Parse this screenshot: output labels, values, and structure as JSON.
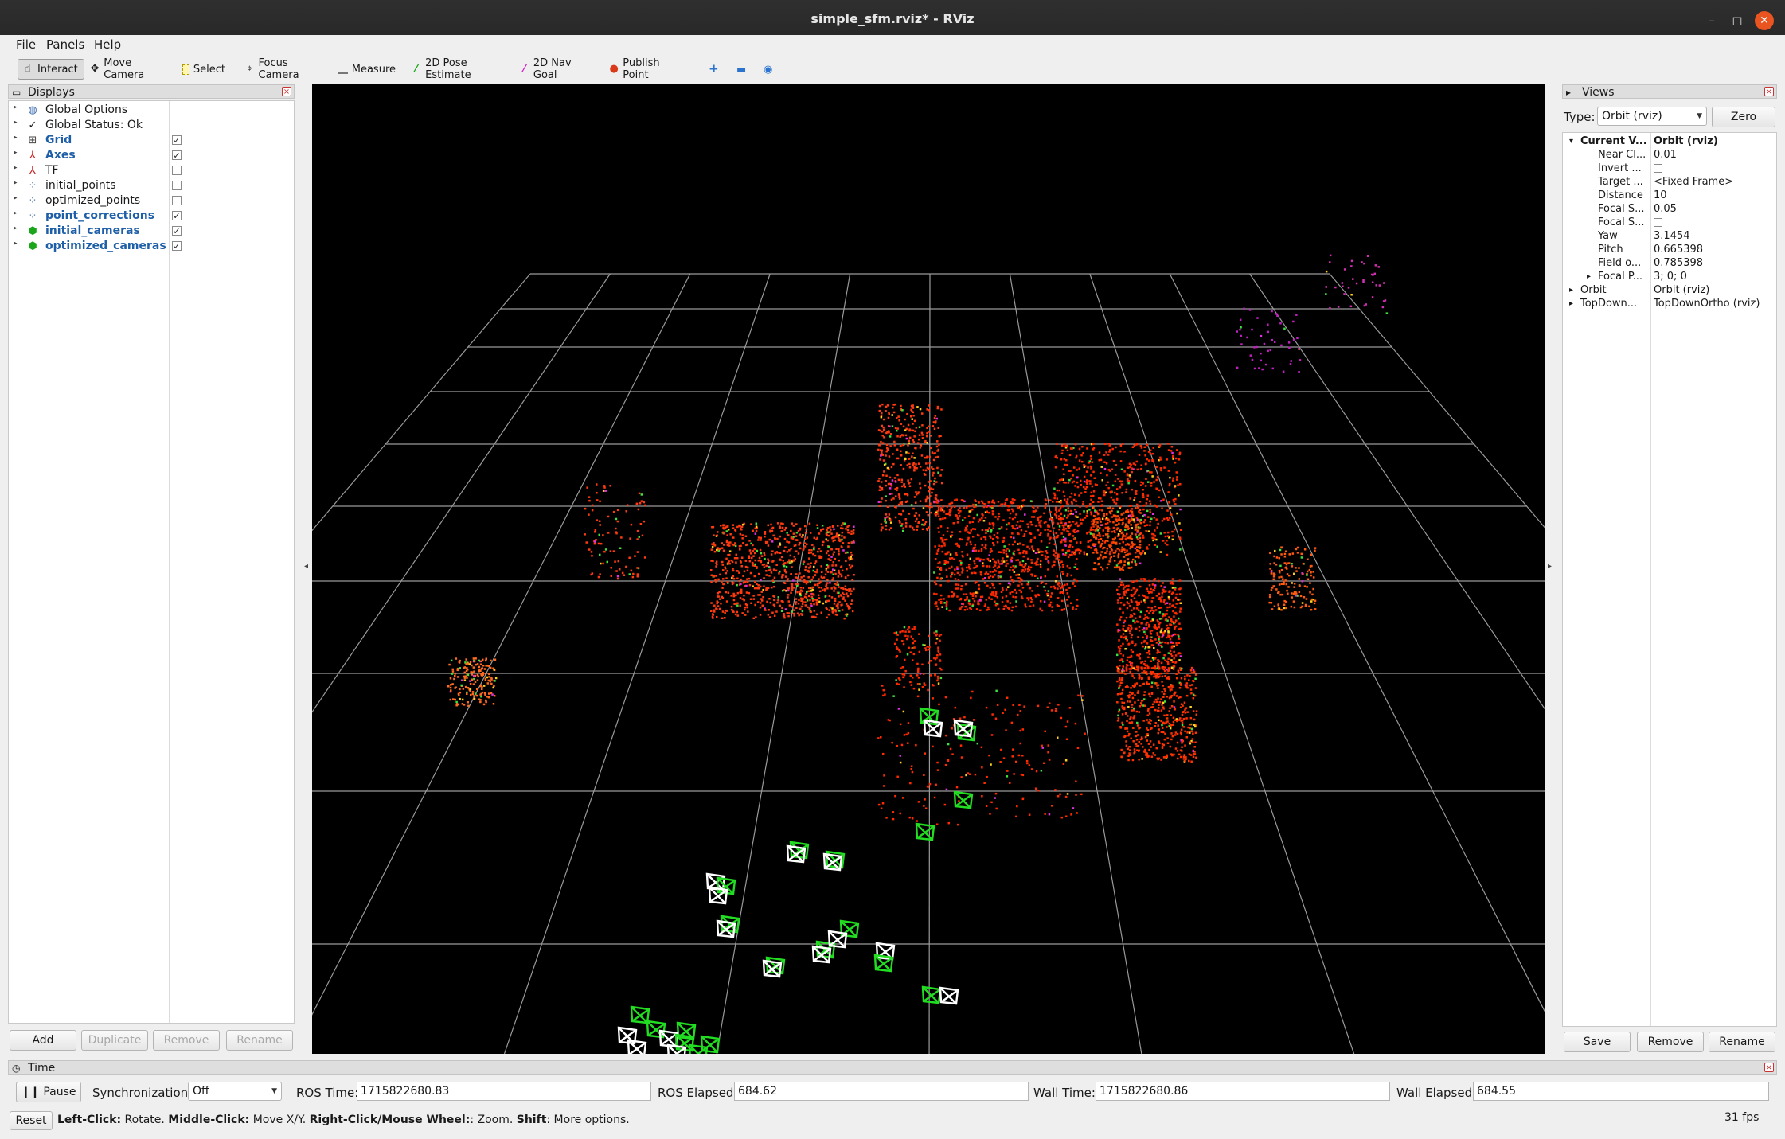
{
  "window": {
    "title": "simple_sfm.rviz* - RViz"
  },
  "menu": {
    "file": "File",
    "panels": "Panels",
    "help": "Help"
  },
  "toolbar": {
    "interact": "Interact",
    "move_camera": "Move Camera",
    "select": "Select",
    "focus_camera": "Focus Camera",
    "measure": "Measure",
    "pose_estimate": "2D Pose Estimate",
    "nav_goal": "2D Nav Goal",
    "publish_point": "Publish Point"
  },
  "displays": {
    "title": "Displays",
    "items": [
      {
        "label": "Global Options",
        "icon": "globe-icon",
        "checkbox": null,
        "enabled": false
      },
      {
        "label": "Global Status: Ok",
        "icon": "checkmark-icon",
        "checkbox": null,
        "enabled": false
      },
      {
        "label": "Grid",
        "icon": "grid-icon",
        "checkbox": true,
        "enabled": true
      },
      {
        "label": "Axes",
        "icon": "axes-icon",
        "checkbox": true,
        "enabled": true
      },
      {
        "label": "TF",
        "icon": "tf-icon",
        "checkbox": false,
        "enabled": false
      },
      {
        "label": "initial_points",
        "icon": "pointcloud-icon",
        "checkbox": false,
        "enabled": false
      },
      {
        "label": "optimized_points",
        "icon": "pointcloud-icon",
        "checkbox": false,
        "enabled": false
      },
      {
        "label": "point_corrections",
        "icon": "pointcloud-icon",
        "checkbox": true,
        "enabled": true
      },
      {
        "label": "initial_cameras",
        "icon": "marker-icon",
        "checkbox": true,
        "enabled": true
      },
      {
        "label": "optimized_cameras",
        "icon": "marker-icon",
        "checkbox": true,
        "enabled": true
      }
    ],
    "buttons": {
      "add": "Add",
      "duplicate": "Duplicate",
      "remove": "Remove",
      "rename": "Rename"
    }
  },
  "views": {
    "title": "Views",
    "type_label": "Type:",
    "type_value": "Orbit (rviz)",
    "zero": "Zero",
    "rows": [
      {
        "key": "Current V...",
        "value": "Orbit (rviz)",
        "bold": true,
        "indent": 0,
        "arrow": "▾"
      },
      {
        "key": "Near Cl...",
        "value": "0.01",
        "indent": 1
      },
      {
        "key": "Invert ...",
        "value": "",
        "checkbox": true,
        "indent": 1
      },
      {
        "key": "Target ...",
        "value": "<Fixed Frame>",
        "indent": 1
      },
      {
        "key": "Distance",
        "value": "10",
        "indent": 1
      },
      {
        "key": "Focal S...",
        "value": "0.05",
        "indent": 1
      },
      {
        "key": "Focal S...",
        "value": "",
        "checkbox": true,
        "indent": 1
      },
      {
        "key": "Yaw",
        "value": "3.1454",
        "indent": 1
      },
      {
        "key": "Pitch",
        "value": "0.665398",
        "indent": 1
      },
      {
        "key": "Field o...",
        "value": "0.785398",
        "indent": 1
      },
      {
        "key": "Focal P...",
        "value": "3; 0; 0",
        "indent": 1,
        "arrow": "▸"
      },
      {
        "key": "Orbit",
        "value": "Orbit (rviz)",
        "indent": 0,
        "arrow": "▸"
      },
      {
        "key": "TopDown...",
        "value": "TopDownOrtho (rviz)",
        "indent": 0,
        "arrow": "▸"
      }
    ],
    "buttons": {
      "save": "Save",
      "remove": "Remove",
      "rename": "Rename"
    }
  },
  "time": {
    "title": "Time",
    "pause": "Pause",
    "sync_label": "Synchronization:",
    "sync_value": "Off",
    "ros_time_label": "ROS Time:",
    "ros_time": "1715822680.83",
    "ros_elapsed_label": "ROS Elapsed:",
    "ros_elapsed": "684.62",
    "wall_time_label": "Wall Time:",
    "wall_time": "1715822680.86",
    "wall_elapsed_label": "Wall Elapsed:",
    "wall_elapsed": "684.55"
  },
  "statusbar": {
    "reset": "Reset",
    "h1": "Left-Click:",
    "t1": " Rotate. ",
    "h2": "Middle-Click:",
    "t2": " Move X/Y. ",
    "h3": "Right-Click/Mouse Wheel:",
    "t3": ": Zoom. ",
    "h4": "Shift",
    "t4": ": More options.",
    "fps": "31 fps"
  },
  "colors": {
    "accent": "#1f5fa8",
    "point": "#ff2a00",
    "camera_green": "#22dd22",
    "camera_white": "#ffffff",
    "close": "#e95420"
  }
}
